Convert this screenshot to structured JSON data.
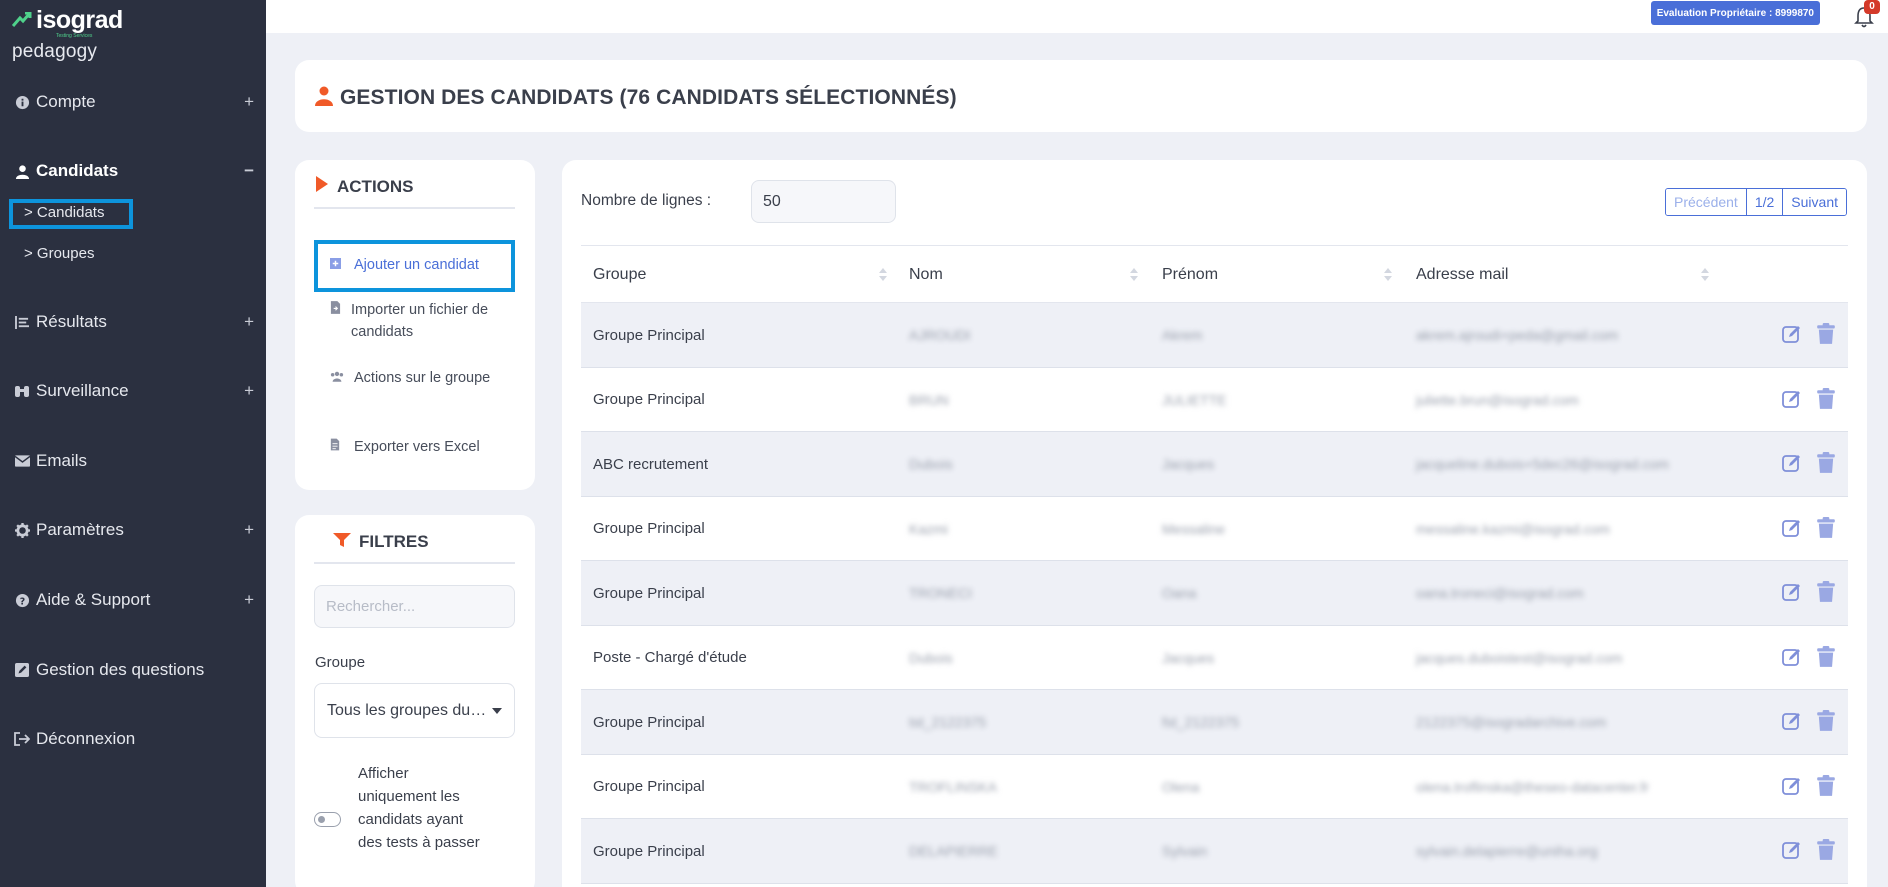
{
  "brand": {
    "logo": "isograd",
    "tag": "Testing Services",
    "sub": "pedagogy"
  },
  "topbar": {
    "eval_badge": "Evaluation Propriétaire : 8999870",
    "notif_count": "0"
  },
  "sidebar": {
    "items": [
      {
        "label": "Compte",
        "icon": "info-icon",
        "expand": "+"
      },
      {
        "label": "Candidats",
        "icon": "user-icon",
        "expand": "−"
      },
      {
        "label": "Résultats",
        "icon": "list-icon",
        "expand": "+"
      },
      {
        "label": "Surveillance",
        "icon": "binoculars-icon",
        "expand": "+"
      },
      {
        "label": "Emails",
        "icon": "envelope-icon",
        "expand": ""
      },
      {
        "label": "Paramètres",
        "icon": "gear-icon",
        "expand": "+"
      },
      {
        "label": "Aide & Support",
        "icon": "question-icon",
        "expand": "+"
      },
      {
        "label": "Gestion des questions",
        "icon": "edit-icon",
        "expand": ""
      },
      {
        "label": "Déconnexion",
        "icon": "logout-icon",
        "expand": ""
      }
    ],
    "sub_items": [
      {
        "label": "> Candidats"
      },
      {
        "label": "> Groupes"
      }
    ]
  },
  "page": {
    "title": "GESTION DES CANDIDATS (76 CANDIDATS SÉLECTIONNÉS)"
  },
  "actions": {
    "heading": "ACTIONS",
    "items": [
      {
        "label": "Ajouter un candidat",
        "icon": "add-icon"
      },
      {
        "label": "Importer un fichier de candidats",
        "icon": "file-import-icon"
      },
      {
        "label": "Actions sur le groupe",
        "icon": "group-icon"
      },
      {
        "label": "Exporter vers Excel",
        "icon": "excel-icon"
      }
    ]
  },
  "filters": {
    "heading": "FILTRES",
    "search_placeholder": "Rechercher...",
    "group_label": "Groupe",
    "group_value": "Tous les groupes du…",
    "toggle_label": "Afficher uniquement les candidats ayant des tests à passer"
  },
  "table": {
    "rows_label": "Nombre de lignes :",
    "rows_value": "50",
    "pager": {
      "prev": "Précédent",
      "page": "1/2",
      "next": "Suivant"
    },
    "columns": [
      "Groupe",
      "Nom",
      "Prénom",
      "Adresse mail"
    ],
    "rows": [
      {
        "groupe": "Groupe Principal",
        "nom": "AJROUDI",
        "prenom": "Akrem",
        "mail": "akrem.ajroudi+peda@gmail.com"
      },
      {
        "groupe": "Groupe Principal",
        "nom": "BRUN",
        "prenom": "JULIETTE",
        "mail": "juliette.brun@isograd.com"
      },
      {
        "groupe": "ABC recrutement",
        "nom": "Dubois",
        "prenom": "Jacques",
        "mail": "jacqueline.dubois+5dec26@isograd.com"
      },
      {
        "groupe": "Groupe Principal",
        "nom": "Kazmi",
        "prenom": "Messaline",
        "mail": "messaline.kazmi@isograd.com"
      },
      {
        "groupe": "Groupe Principal",
        "nom": "TRONECI",
        "prenom": "Oana",
        "mail": "oana.troneci@isograd.com"
      },
      {
        "groupe": "Poste - Chargé d'étude",
        "nom": "Dubois",
        "prenom": "Jacques",
        "mail": "jacques.duboistest@isograd.com"
      },
      {
        "groupe": "Groupe Principal",
        "nom": "tst_2122375",
        "prenom": "fst_2122375",
        "mail": "2122375@isogradarchive.com"
      },
      {
        "groupe": "Groupe Principal",
        "nom": "TROFLINSKA",
        "prenom": "Olena",
        "mail": "olena.troflinska@theseo-datacenter.fr"
      },
      {
        "groupe": "Groupe Principal",
        "nom": "DELAPIERRE",
        "prenom": "Sylvain",
        "mail": "sylvain.delapierre@uniha.org"
      }
    ]
  },
  "colors": {
    "sidebar_bg": "#2b3040",
    "accent": "#4a6fd8",
    "highlight": "#0d94dc",
    "brand_orange": "#f05a28"
  }
}
